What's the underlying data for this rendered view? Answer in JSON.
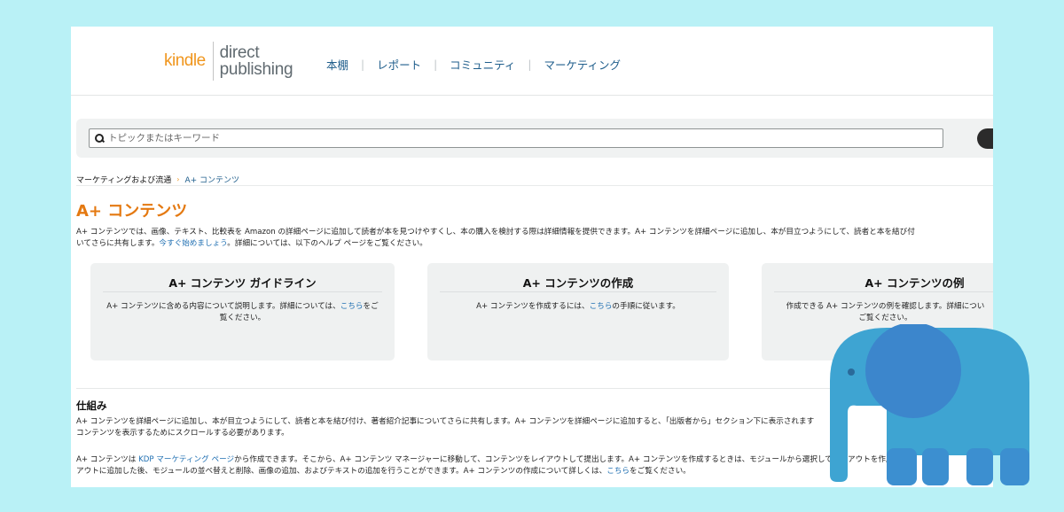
{
  "header": {
    "logo_kindle": "kindle",
    "logo_direct": "direct",
    "logo_publishing": "publishing",
    "nav": [
      {
        "label": "本棚"
      },
      {
        "label": "レポート"
      },
      {
        "label": "コミュニティ"
      },
      {
        "label": "マーケティング"
      }
    ]
  },
  "search": {
    "placeholder": "トピックまたはキーワード"
  },
  "breadcrumb": {
    "parent": "マーケティングおよび流通",
    "separator": "›",
    "current": "A+ コンテンツ"
  },
  "page_title": "A+ コンテンツ",
  "intro": {
    "text1": "A+ コンテンツでは、画像、テキスト、比較表を Amazon の詳細ページに追加して読者が本を見つけやすくし、本の購入を検討する際は詳細情報を提供できます。A+ コンテンツを詳細ページに追加し、本が目立つようにして、読者と本を結び付",
    "text2": "いてさらに共有します。",
    "link": "今すぐ始めましょう",
    "text3": "。詳細については、以下のヘルプ ページをご覧ください。"
  },
  "cards": [
    {
      "title": "A+ コンテンツ ガイドライン",
      "body_text": "A+ コンテンツに含める内容について説明します。詳細については、",
      "body_link": "こちら",
      "body_text2": "をご覧ください。"
    },
    {
      "title": "A+ コンテンツの作成",
      "body_text": "A+ コンテンツを作成するには、",
      "body_link": "こちら",
      "body_text2": "の手順に従います。"
    },
    {
      "title": "A+ コンテンツの例",
      "body_text": "作成できる A+ コンテンツの例を確認します。詳細につい",
      "body_text2": "ご覧ください。"
    }
  ],
  "section": {
    "title": "仕組み",
    "para1_line1": "A+ コンテンツを詳細ページに追加し、本が目立つようにして、読者と本を結び付け、著者紹介記事についてさらに共有します。A+ コンテンツを詳細ページに追加すると、「出版者から」セクション下に表示されます",
    "para1_line2": "コンテンツを表示するためにスクロールする必要があります。",
    "para2_text1": "A+ コンテンツは ",
    "para2_link1": "KDP マーケティング ページ",
    "para2_text2": "から作成できます。そこから、A+ コンテンツ マネージャーに移動して、コンテンツをレイアウトして提出します。A+ コンテンツを作成するときは、モジュールから選択してレイアウトを作成",
    "para2_line2_text": "アウトに追加した後、モジュールの並べ替えと削除、画像の追加、およびテキストの追加を行うことができます。A+ コンテンツの作成について詳しくは、",
    "para2_link2": "こちら",
    "para2_line2_end": "をご覧ください。"
  },
  "colors": {
    "background": "#b9f1f6",
    "kindle_orange": "#f0961e",
    "title_orange": "#e47911",
    "link_blue": "#1f6fb2",
    "elephant_body": "#3ea4d2",
    "elephant_ear": "#3c86cc"
  },
  "icons": {
    "search": "search-icon",
    "logo": "elephant-icon"
  }
}
